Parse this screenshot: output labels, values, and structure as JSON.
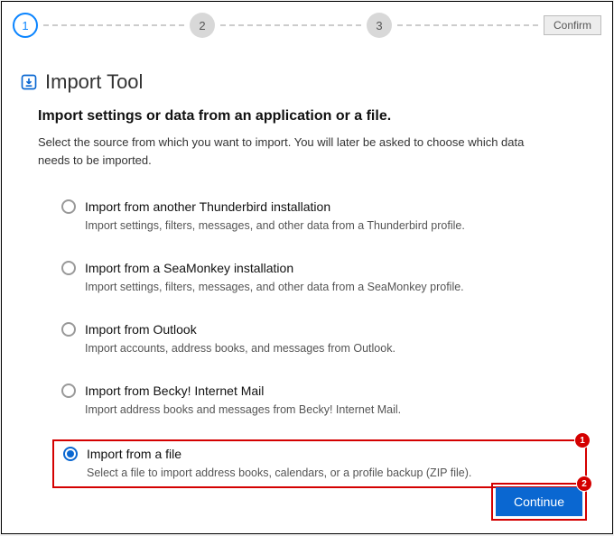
{
  "stepper": {
    "steps": [
      "1",
      "2",
      "3"
    ],
    "active_index": 0,
    "confirm_label": "Confirm"
  },
  "page": {
    "title": "Import Tool",
    "heading": "Import settings or data from an application or a file.",
    "description": "Select the source from which you want to import. You will later be asked to choose which data needs to be imported."
  },
  "options": [
    {
      "label": "Import from another Thunderbird installation",
      "desc": "Import settings, filters, messages, and other data from a Thunderbird profile.",
      "selected": false
    },
    {
      "label": "Import from a SeaMonkey installation",
      "desc": "Import settings, filters, messages, and other data from a SeaMonkey profile.",
      "selected": false
    },
    {
      "label": "Import from Outlook",
      "desc": "Import accounts, address books, and messages from Outlook.",
      "selected": false
    },
    {
      "label": "Import from Becky! Internet Mail",
      "desc": "Import address books and messages from Becky! Internet Mail.",
      "selected": false
    },
    {
      "label": "Import from a file",
      "desc": "Select a file to import address books, calendars, or a profile backup (ZIP file).",
      "selected": true
    }
  ],
  "callouts": {
    "option_badge": "1",
    "button_badge": "2"
  },
  "buttons": {
    "continue": "Continue"
  }
}
